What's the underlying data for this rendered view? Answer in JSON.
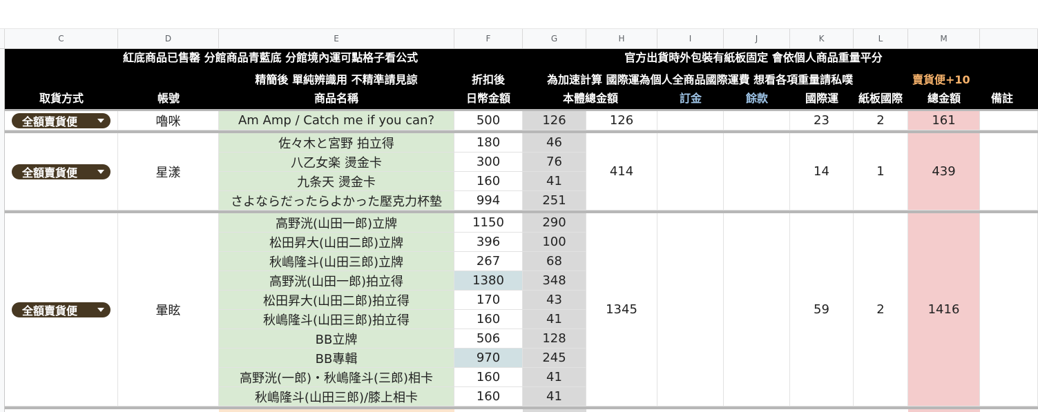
{
  "columns": [
    "C",
    "D",
    "E",
    "F",
    "G",
    "H",
    "I",
    "J",
    "K",
    "L",
    "M"
  ],
  "header": {
    "line1_left": "紅底商品已售罄  分館商品青藍底 分館境內運可點格子看公式",
    "line1_right": "官方出貨時外包裝有紙板固定 會依個人商品重量平分",
    "line2_e": "精簡後 單純辨識用 不精準請見諒",
    "line2_f": "折扣後",
    "line2_right": "為加速計算 國際運為個人全商品國際運費 想看各項重量請私噗",
    "line2_bonus": "賣貨便+10",
    "pickup": "取貨方式",
    "account": "帳號",
    "product": "商品名稱",
    "jpy": "日幣金額",
    "subtotal": "本體總金額",
    "deposit": "訂金",
    "balance": "餘款",
    "intl": "國際運",
    "board": "紙板國際",
    "total": "總金額",
    "note": "備註"
  },
  "groups": [
    {
      "pickup": "全額賣貨便",
      "account": "嚕咪",
      "subtotal": "126",
      "intl": "23",
      "board": "2",
      "total": "161",
      "items": [
        {
          "name": "Am Amp / Catch me if you can?",
          "jpy": "500",
          "twd": "126",
          "branch": false
        }
      ]
    },
    {
      "pickup": "全額賣貨便",
      "account": "星漾",
      "subtotal": "414",
      "intl": "14",
      "board": "1",
      "total": "439",
      "items": [
        {
          "name": "佐々木と宮野 拍立得",
          "jpy": "180",
          "twd": "46",
          "branch": false
        },
        {
          "name": "八乙女楽 燙金卡",
          "jpy": "300",
          "twd": "76",
          "branch": false
        },
        {
          "name": "九条天 燙金卡",
          "jpy": "160",
          "twd": "41",
          "branch": false
        },
        {
          "name": "さよならだったらよかった壓克力杯墊",
          "jpy": "994",
          "twd": "251",
          "branch": false
        }
      ]
    },
    {
      "pickup": "全額賣貨便",
      "account": "暈眩",
      "subtotal": "1345",
      "intl": "59",
      "board": "2",
      "total": "1416",
      "items": [
        {
          "name": "高野洸(山田一郎)立牌",
          "jpy": "1150",
          "twd": "290",
          "branch": false
        },
        {
          "name": "松田昇大(山田二郎)立牌",
          "jpy": "396",
          "twd": "100",
          "branch": false
        },
        {
          "name": "秋嶋隆斗(山田三郎)立牌",
          "jpy": "267",
          "twd": "68",
          "branch": false
        },
        {
          "name": "高野洸(山田一郎)拍立得",
          "jpy": "1380",
          "twd": "348",
          "branch": true
        },
        {
          "name": "松田昇大(山田二郎)拍立得",
          "jpy": "170",
          "twd": "43",
          "branch": false
        },
        {
          "name": "秋嶋隆斗(山田三郎)拍立得",
          "jpy": "160",
          "twd": "41",
          "branch": false
        },
        {
          "name": "BB立牌",
          "jpy": "506",
          "twd": "128",
          "branch": false
        },
        {
          "name": "BB專輯",
          "jpy": "970",
          "twd": "245",
          "branch": true
        },
        {
          "name": "高野洸(一郎)・秋嶋隆斗(三郎)相卡",
          "jpy": "160",
          "twd": "41",
          "branch": false
        },
        {
          "name": "秋嶋隆斗(山田三郎)/膝上相卡",
          "jpy": "160",
          "twd": "41",
          "branch": false
        }
      ]
    }
  ],
  "colors": {
    "header_bg": "#000000",
    "product_bg": "#d9ead3",
    "twd_bg": "#d9d9d9",
    "total_bg": "#f4cccc",
    "branch_bg": "#d0e0e3",
    "chip_bg": "#473822",
    "deposit_text": "#9fc5e8",
    "bonus_text": "#f6b26b"
  }
}
